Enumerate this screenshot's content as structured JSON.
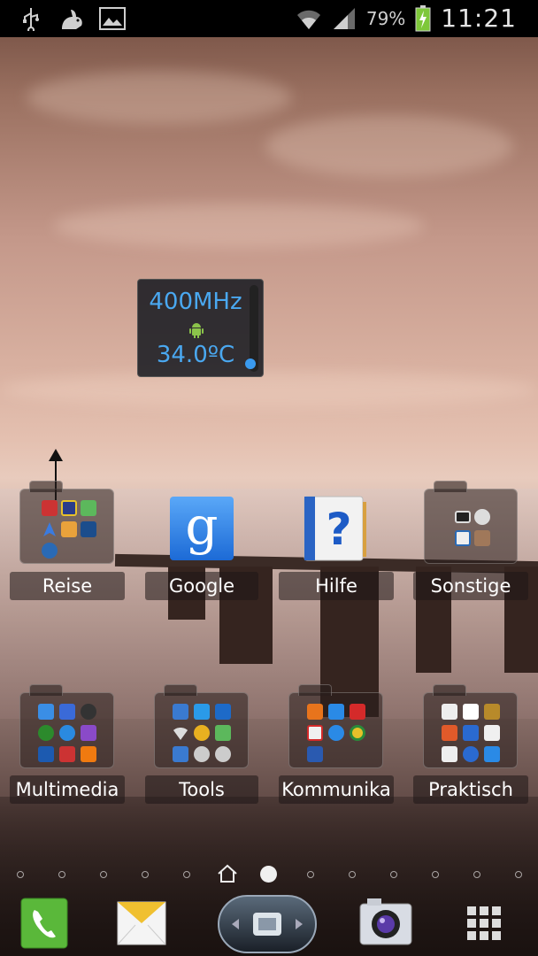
{
  "status_bar": {
    "left_icons": [
      "usb-icon",
      "debug-rabbit-icon",
      "gallery-icon"
    ],
    "right_icons": [
      "wifi-icon",
      "signal-icon",
      "battery-charging-icon"
    ],
    "battery_percent": "79%",
    "time": "11:21"
  },
  "widget": {
    "frequency": "400MHz",
    "temperature": "34.0ºC",
    "icon": "android-icon"
  },
  "row1": [
    {
      "label": "Reise",
      "type": "folder"
    },
    {
      "label": "Google",
      "type": "app",
      "icon": "google-search-icon"
    },
    {
      "label": "Hilfe",
      "type": "app",
      "icon": "help-icon"
    },
    {
      "label": "Sonstige",
      "type": "folder"
    }
  ],
  "row2": [
    {
      "label": "Multimedia",
      "type": "folder"
    },
    {
      "label": "Tools",
      "type": "folder"
    },
    {
      "label": "Kommunika",
      "type": "folder"
    },
    {
      "label": "Praktisch",
      "type": "folder"
    }
  ],
  "pager": {
    "page_count": 13,
    "active_index": 6,
    "home_index": 5
  },
  "dock": [
    "phone-icon",
    "messaging-icon",
    "app-drawer-handle-icon",
    "camera-icon",
    "apps-grid-icon"
  ],
  "colors": {
    "widget_text": "#4aa8f0",
    "statusbar_bg": "#000000",
    "battery_green": "#7ec83a"
  }
}
